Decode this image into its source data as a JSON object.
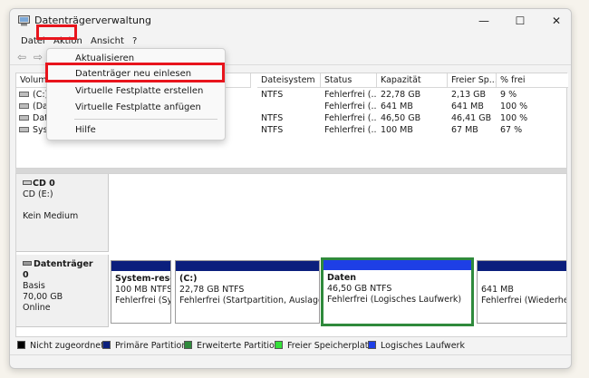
{
  "window": {
    "title": "Datenträgerverwaltung",
    "controls": {
      "minimize": "—",
      "maximize": "☐",
      "close": "✕"
    }
  },
  "menu": {
    "items": [
      "Datei",
      "Aktion",
      "Ansicht",
      "?"
    ],
    "dropdown": {
      "items": [
        "Aktualisieren",
        "Datenträger neu einlesen",
        "Virtuelle Festplatte erstellen",
        "Virtuelle Festplatte anfügen",
        "Hilfe"
      ]
    }
  },
  "toolbar": {
    "back_icon": "back-arrow-icon",
    "forward_icon": "forward-arrow-icon"
  },
  "volume_table": {
    "headers": [
      "Volume",
      "Dateisystem",
      "Status",
      "Kapazität",
      "Freier Sp...",
      "% frei"
    ],
    "rows": [
      {
        "volume": "(C:)",
        "fs": "NTFS",
        "status": "Fehlerfrei (...",
        "capacity": "22,78 GB",
        "free": "2,13 GB",
        "pct": "9 %"
      },
      {
        "volume": "(Dat",
        "fs": "",
        "status": "Fehlerfrei (...",
        "capacity": "641 MB",
        "free": "641 MB",
        "pct": "100 %"
      },
      {
        "volume": "Date",
        "fs": "NTFS",
        "status": "Fehlerfrei (...",
        "capacity": "46,50 GB",
        "free": "46,41 GB",
        "pct": "100 %"
      },
      {
        "volume": "Syst",
        "fs": "NTFS",
        "status": "Fehlerfrei (...",
        "capacity": "100 MB",
        "free": "67 MB",
        "pct": "67 %"
      }
    ]
  },
  "disks": [
    {
      "name": "CD 0",
      "line2": "CD (E:)",
      "line3": "",
      "line4": "Kein Medium"
    },
    {
      "name": "Datenträger 0",
      "line2": "Basis",
      "line3": "70,00 GB",
      "line4": "Online",
      "partitions": [
        {
          "name": "System-reser",
          "size": "100 MB NTFS",
          "status": "Fehlerfrei (Sys"
        },
        {
          "name": "(C:)",
          "size": "22,78 GB NTFS",
          "status": "Fehlerfrei (Startpartition, Auslager"
        },
        {
          "name": "Daten",
          "size": "46,50 GB NTFS",
          "status": "Fehlerfrei (Logisches Laufwerk)"
        },
        {
          "name": "",
          "size": "641 MB",
          "status": "Fehlerfrei (Wiederhers"
        }
      ]
    }
  ],
  "legend": [
    {
      "label": "Nicht zugeordnet",
      "color": "#000000"
    },
    {
      "label": "Primäre Partition",
      "color": "#0b1f7d"
    },
    {
      "label": "Erweiterte Partition",
      "color": "#2f8a3c"
    },
    {
      "label": "Freier Speicherplatz",
      "color": "#34e03a"
    },
    {
      "label": "Logisches Laufwerk",
      "color": "#1e3fe6"
    }
  ],
  "colors": {
    "highlight": "#e8141c",
    "primary_partition": "#0b1f7d",
    "logical_drive": "#1e3fe6",
    "selection": "#2f8a3c"
  }
}
